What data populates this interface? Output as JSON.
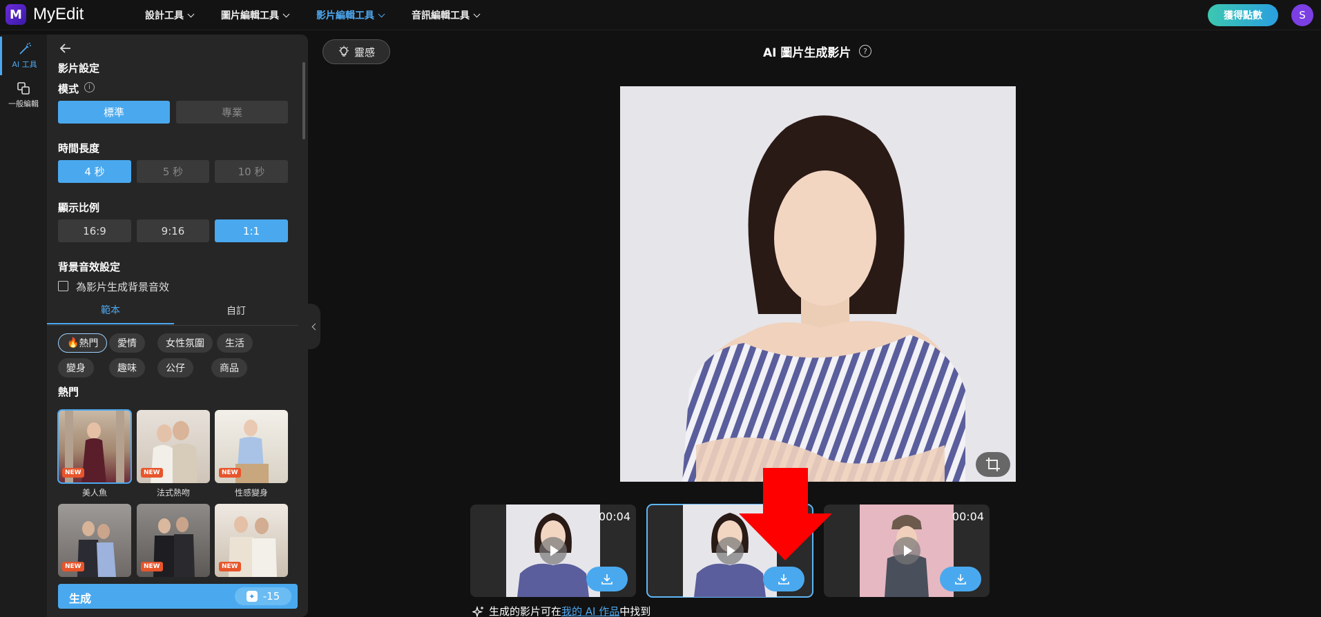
{
  "header": {
    "logo_text": "MyEdit",
    "nav": [
      {
        "label": "設計工具",
        "active": false
      },
      {
        "label": "圖片編輯工具",
        "active": false
      },
      {
        "label": "影片編輯工具",
        "active": true
      },
      {
        "label": "音訊編輯工具",
        "active": false
      }
    ],
    "points_button": "獲得點數",
    "avatar_initial": "S"
  },
  "rail": {
    "items": [
      {
        "label": "AI 工具",
        "icon": "magic-wand-icon",
        "active": true
      },
      {
        "label": "一般編輯",
        "icon": "layers-icon",
        "active": false
      }
    ]
  },
  "panel": {
    "title": "影片設定",
    "mode": {
      "label": "模式",
      "options": [
        "標準",
        "專業"
      ],
      "selected": "標準"
    },
    "duration": {
      "label": "時間長度",
      "options": [
        "4 秒",
        "5 秒",
        "10 秒"
      ],
      "selected": "4 秒"
    },
    "ratio": {
      "label": "顯示比例",
      "options": [
        "16:9",
        "9:16",
        "1:1"
      ],
      "selected": "1:1"
    },
    "bg_sound": {
      "label": "背景音效設定",
      "checkbox_label": "為影片生成背景音效",
      "checked": false
    },
    "tabs": [
      "範本",
      "自訂"
    ],
    "active_tab": "範本",
    "chips": [
      "熱門",
      "愛情",
      "女性氛圍",
      "生活",
      "變身",
      "趣味",
      "公仔",
      "商品"
    ],
    "active_chip": "熱門",
    "chip_hot_emoji": "🔥",
    "section_heading": "熱門",
    "templates": [
      {
        "label": "美人魚",
        "badge": "NEW"
      },
      {
        "label": "法式熱吻",
        "badge": "NEW"
      },
      {
        "label": "性感變身",
        "badge": "NEW"
      },
      {
        "label": "",
        "badge": "NEW"
      },
      {
        "label": "",
        "badge": "NEW"
      },
      {
        "label": "",
        "badge": "NEW"
      }
    ],
    "generate_label": "生成",
    "generate_cost": "-15"
  },
  "main": {
    "inspire_label": "靈感",
    "title": "AI 圖片生成影片",
    "help": "?",
    "results": [
      {
        "duration": "00:04",
        "selected": false
      },
      {
        "duration": "",
        "selected": true
      },
      {
        "duration": "00:04",
        "selected": false
      }
    ],
    "footer_prefix": "生成的影片可在",
    "footer_link": "我的 AI 作品",
    "footer_suffix": "中找到"
  },
  "colors": {
    "accent": "#4aa9ee",
    "arrow": "#ff0000",
    "brand": "#6a2cd8"
  }
}
